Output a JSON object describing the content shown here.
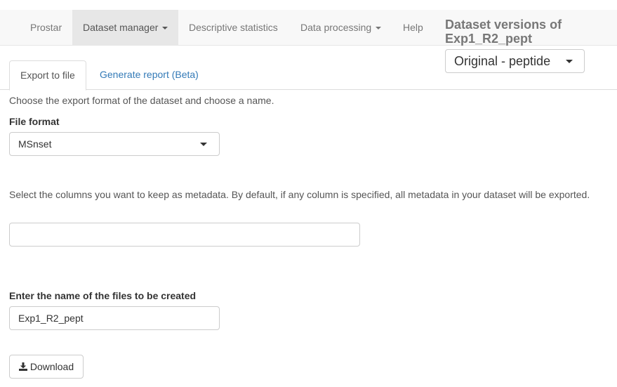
{
  "navbar": {
    "items": [
      {
        "label": "Prostar"
      },
      {
        "label": "Dataset manager"
      },
      {
        "label": "Descriptive statistics"
      },
      {
        "label": "Data processing"
      },
      {
        "label": "Help"
      }
    ],
    "versions_title": "Dataset versions of Exp1_R2_pept",
    "version_select": {
      "value": "Original - peptide"
    }
  },
  "tabs": [
    {
      "label": "Export to file"
    },
    {
      "label": "Generate report (Beta)"
    }
  ],
  "export": {
    "intro": "Choose the export format of the dataset and choose a name.",
    "file_format_label": "File format",
    "file_format_value": "MSnset",
    "metadata_help": "Select the columns you want to keep as metadata. By default, if any column is specified, all metadata in your dataset will be exported.",
    "filename_label": "Enter the name of the files to be created",
    "filename_value": "Exp1_R2_pept",
    "download_label": "Download"
  },
  "icons": {
    "download": "download-icon",
    "caret": "caret-down-icon"
  }
}
